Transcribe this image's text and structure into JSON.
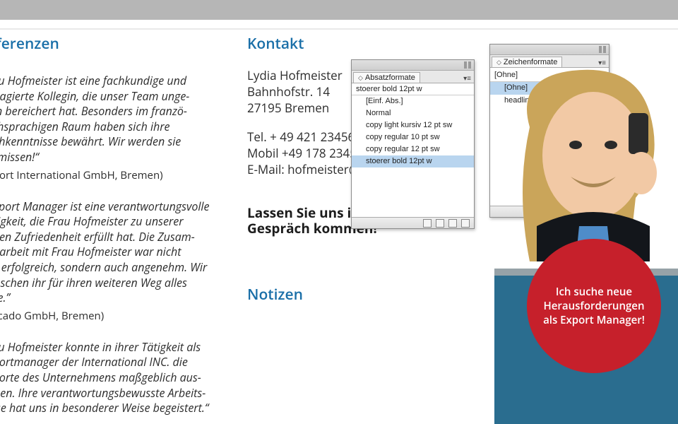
{
  "sections": {
    "referenzen_title": "eferenzen",
    "kontakt_title": "Kontakt",
    "notizen_title": "Notizen",
    "cta_line1": "Lassen Sie uns ins",
    "cta_line2": "Gespräch kommen!"
  },
  "refs": [
    {
      "quote": "rau Hofmeister ist eine fachkundige und ngagierte Kollegin, die unser Team unge-\nein bereichert hat. Besonders im franzö-\nschsprachigen Raum haben sich ihre\nachkenntnisse bewährt. Wir werden sie\nermissen!“",
      "attrib": "xport International GmbH, Bremen)"
    },
    {
      "quote": "Export Manager ist eine verantwortungsvolle\nätigkeit, die Frau Hofmeister zu unserer\nollen Zufriedenheit erfüllt hat. Die Zusam-\nenarbeit mit Frau Hofmeister war nicht\nur erfolgreich, sondern auch angenehm. Wir\nünschen ihr für ihren weiteren Weg alles\nute.”",
      "attrib": "ercado GmbH, Bremen)"
    },
    {
      "quote": "rau Hofmeister konnte in ihrer Tätigkeit als\nxportmanager der International INC. die\nxporte des Unternehmens maßgeblich aus-\nauen. Ihre verantwortungsbewusste Arbeits-\neise hat uns in besonderer Weise begeistert.“",
      "attrib": ""
    }
  ],
  "kontakt": {
    "name": "Lydia Hofmeister",
    "street": "Bahnhofstr. 14",
    "city": "27195 Bremen",
    "tel": "Tel. + 49 421 234567",
    "mobil": "Mobil +49 178 2345678",
    "email": "E-Mail: hofmeister@gmx."
  },
  "panels": {
    "absatz": {
      "title": "Absatzformate",
      "current": "stoerer bold 12pt w",
      "items": [
        {
          "label": "[Einf. Abs.]",
          "selected": false
        },
        {
          "label": "Normal",
          "selected": false
        },
        {
          "label": "copy light kursiv 12 pt sw",
          "selected": false
        },
        {
          "label": "copy regular 10 pt sw",
          "selected": false
        },
        {
          "label": "copy regular 12 pt sw",
          "selected": false
        },
        {
          "label": "stoerer bold 12pt w",
          "selected": true
        }
      ]
    },
    "zeichen": {
      "title": "Zeichenformate",
      "current": "[Ohne]",
      "items": [
        {
          "label": "[Ohne]",
          "selected": true
        },
        {
          "label": "headline  12 pt blau",
          "selected": false
        }
      ]
    }
  },
  "bubble": {
    "line1": "Ich suche neue",
    "line2": "Herausforderungen",
    "line3": "als Export Manager!"
  }
}
